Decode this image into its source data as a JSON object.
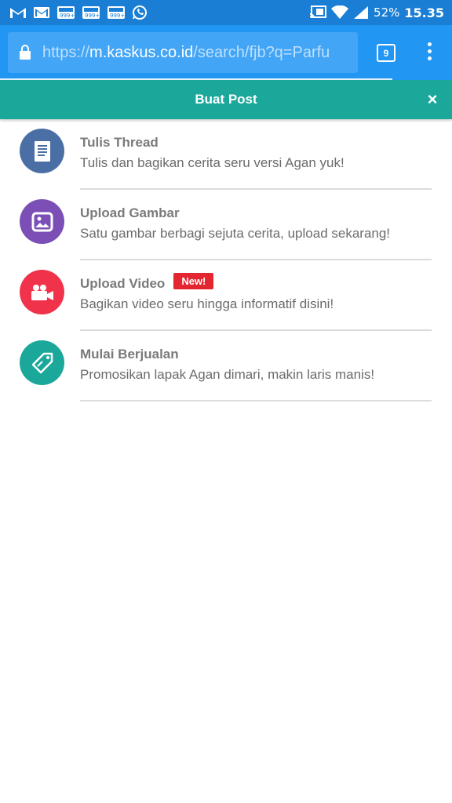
{
  "status_bar": {
    "battery_percent": "52%",
    "time": "15.35",
    "notification_icons": [
      "gmail-icon",
      "gmail-icon",
      "news-999-icon",
      "news-999-icon",
      "news-999-icon",
      "whatsapp-icon"
    ],
    "notification_badge": "999+"
  },
  "browser": {
    "url_scheme": "https://",
    "url_host": "m.kaskus.co.id",
    "url_path": "/search/fjb?q=Parfu",
    "tab_count": "9"
  },
  "modal": {
    "title": "Buat Post",
    "close_label": "×"
  },
  "options": [
    {
      "title": "Tulis Thread",
      "description": "Tulis dan bagikan cerita seru versi Agan yuk!",
      "icon": "document-icon",
      "color": "#4a6fa5"
    },
    {
      "title": "Upload Gambar",
      "description": "Satu gambar berbagi sejuta cerita, upload sekarang!",
      "icon": "image-icon",
      "color": "#7b4fb5"
    },
    {
      "title": "Upload Video",
      "description": "Bagikan video seru hingga informatif disini!",
      "icon": "video-camera-icon",
      "color": "#f0334b",
      "badge": "New!"
    },
    {
      "title": "Mulai Berjualan",
      "description": "Promosikan lapak Agan dimari, makin laris manis!",
      "icon": "tag-icon",
      "color": "#1ba89a"
    }
  ],
  "colors": {
    "status_bar": "#1a7fd4",
    "toolbar": "#2196f3",
    "modal_header": "#1ba89a",
    "badge": "#e3262f"
  }
}
